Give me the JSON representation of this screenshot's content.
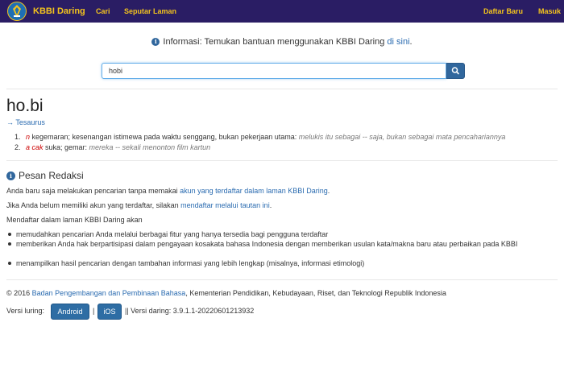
{
  "navbar": {
    "brand": "KBBI Daring",
    "links": [
      "Cari",
      "Seputar Laman"
    ],
    "right_links": [
      "Daftar Baru",
      "Masuk"
    ],
    "background": "#2a1d64",
    "accent": "#f3c31d"
  },
  "info": {
    "icon": "info-icon",
    "text": "Informasi: Temukan bantuan menggunakan KBBI Daring ",
    "link": "di sini",
    "suffix": "."
  },
  "search": {
    "value": "hobi",
    "button_icon": "search-icon"
  },
  "entry": {
    "title": "ho.bi",
    "tesaurus": "→ Tesaurus",
    "definitions": [
      {
        "num": "1.",
        "label": "n",
        "text": " kegemaran; kesenangan istimewa pada waktu senggang, bukan pekerjaan utama: ",
        "example": "melukis itu sebagai -- saja, bukan sebagai mata pencahariannya"
      },
      {
        "num": "2.",
        "label": "a cak",
        "text": " suka; gemar: ",
        "example": "mereka -- sekali menonton film kartun"
      }
    ]
  },
  "pesan": {
    "title": "Pesan Redaksi",
    "p1_text": "Anda baru saja melakukan pencarian tanpa memakai ",
    "p1_link": "akun yang terdaftar dalam laman KBBI Daring",
    "p1_suffix": ".",
    "p2_text": "Jika Anda belum memiliki akun yang terdaftar, silakan ",
    "p2_link": "mendaftar melalui tautan ini",
    "p2_suffix": ".",
    "p3": "Mendaftar dalam laman KBBI Daring akan",
    "bullets": [
      "memudahkan pencarian Anda melalui berbagai fitur yang hanya tersedia bagi pengguna terdaftar",
      "memberikan Anda hak berpartisipasi dalam pengayaan kosakata bahasa Indonesia dengan memberikan usulan kata/makna baru atau perbaikan pada KBBI",
      "menampilkan hasil pencarian dengan tambahan informasi yang lebih lengkap (misalnya, informasi etimologi)"
    ]
  },
  "footer": {
    "copyright": "© 2016 ",
    "org_link": "Badan Pengembangan dan Pembinaan Bahasa",
    "rest": ", Kementerian Pendidikan, Kebudayaan, Riset, dan Teknologi Republik Indonesia",
    "versi_luring": "Versi luring:",
    "android": "Android",
    "pipe": "|",
    "ios": "iOS",
    "versi_daring": "|| Versi daring: 3.9.1.1-20220601213932"
  }
}
